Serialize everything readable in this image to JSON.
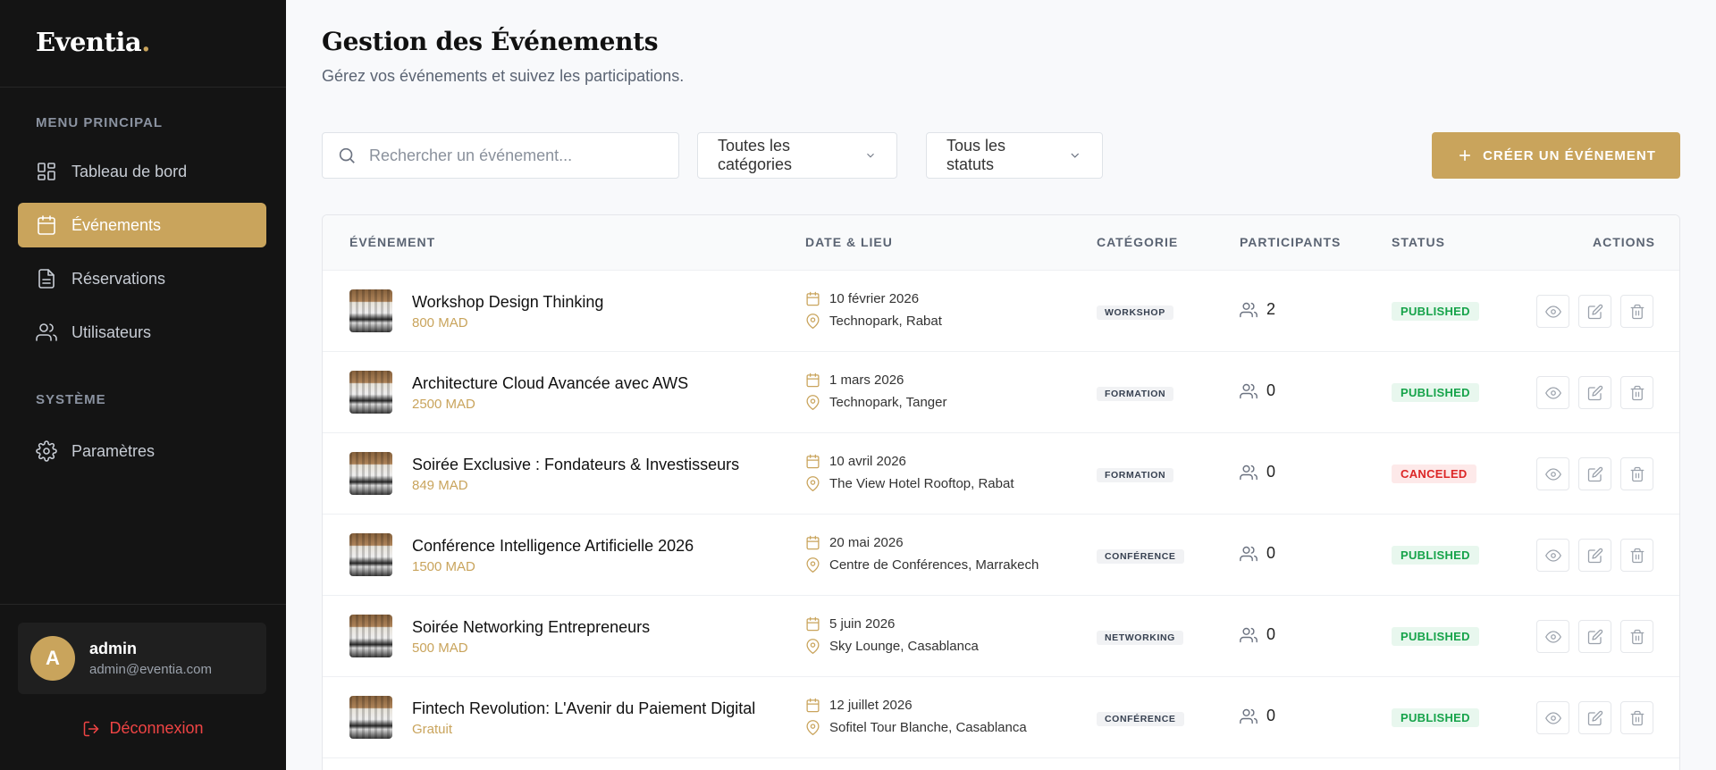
{
  "app": {
    "logo_text": "Eventia",
    "logo_dot": "."
  },
  "sidebar": {
    "section_main": "MENU PRINCIPAL",
    "section_system": "SYSTÈME",
    "items": [
      {
        "label": "Tableau de bord",
        "icon": "dashboard-icon"
      },
      {
        "label": "Événements",
        "icon": "calendar-icon",
        "active": true
      },
      {
        "label": "Réservations",
        "icon": "document-icon"
      },
      {
        "label": "Utilisateurs",
        "icon": "users-icon"
      }
    ],
    "settings_label": "Paramètres",
    "user": {
      "initial": "A",
      "name": "admin",
      "email": "admin@eventia.com"
    },
    "logout_label": "Déconnexion"
  },
  "header": {
    "title": "Gestion des Événements",
    "subtitle": "Gérez vos événements et suivez les participations."
  },
  "toolbar": {
    "search_placeholder": "Rechercher un événement...",
    "category_select": "Toutes les catégories",
    "status_select": "Tous les statuts",
    "create_label": "CRÉER UN ÉVÉNEMENT"
  },
  "table": {
    "headers": {
      "event": "ÉVÉNEMENT",
      "date": "DATE & LIEU",
      "category": "CATÉGORIE",
      "participants": "PARTICIPANTS",
      "status": "STATUS",
      "actions": "ACTIONS"
    },
    "rows": [
      {
        "title": "Workshop Design Thinking",
        "price": "800 MAD",
        "date": "10 février 2026",
        "place": "Technopark, Rabat",
        "category": "WORKSHOP",
        "participants": "2",
        "status": "PUBLISHED",
        "status_kind": "published"
      },
      {
        "title": "Architecture Cloud Avancée avec AWS",
        "price": "2500 MAD",
        "date": "1 mars 2026",
        "place": "Technopark, Tanger",
        "category": "FORMATION",
        "participants": "0",
        "status": "PUBLISHED",
        "status_kind": "published"
      },
      {
        "title": "Soirée Exclusive : Fondateurs & Investisseurs",
        "price": "849 MAD",
        "date": "10 avril 2026",
        "place": "The View Hotel Rooftop, Rabat",
        "category": "FORMATION",
        "participants": "0",
        "status": "CANCELED",
        "status_kind": "canceled"
      },
      {
        "title": "Conférence Intelligence Artificielle 2026",
        "price": "1500 MAD",
        "date": "20 mai 2026",
        "place": "Centre de Conférences, Marrakech",
        "category": "CONFÉRENCE",
        "participants": "0",
        "status": "PUBLISHED",
        "status_kind": "published"
      },
      {
        "title": "Soirée Networking Entrepreneurs",
        "price": "500 MAD",
        "date": "5 juin 2026",
        "place": "Sky Lounge, Casablanca",
        "category": "NETWORKING",
        "participants": "0",
        "status": "PUBLISHED",
        "status_kind": "published"
      },
      {
        "title": "Fintech Revolution: L'Avenir du Paiement Digital",
        "price": "Gratuit",
        "date": "12 juillet 2026",
        "place": "Sofitel Tour Blanche, Casablanca",
        "category": "CONFÉRENCE",
        "participants": "0",
        "status": "PUBLISHED",
        "status_kind": "published"
      }
    ]
  },
  "colors": {
    "accent": "#c9a45c",
    "sidebar_bg": "#141414",
    "published": "#16a34a",
    "canceled": "#dc2626"
  }
}
